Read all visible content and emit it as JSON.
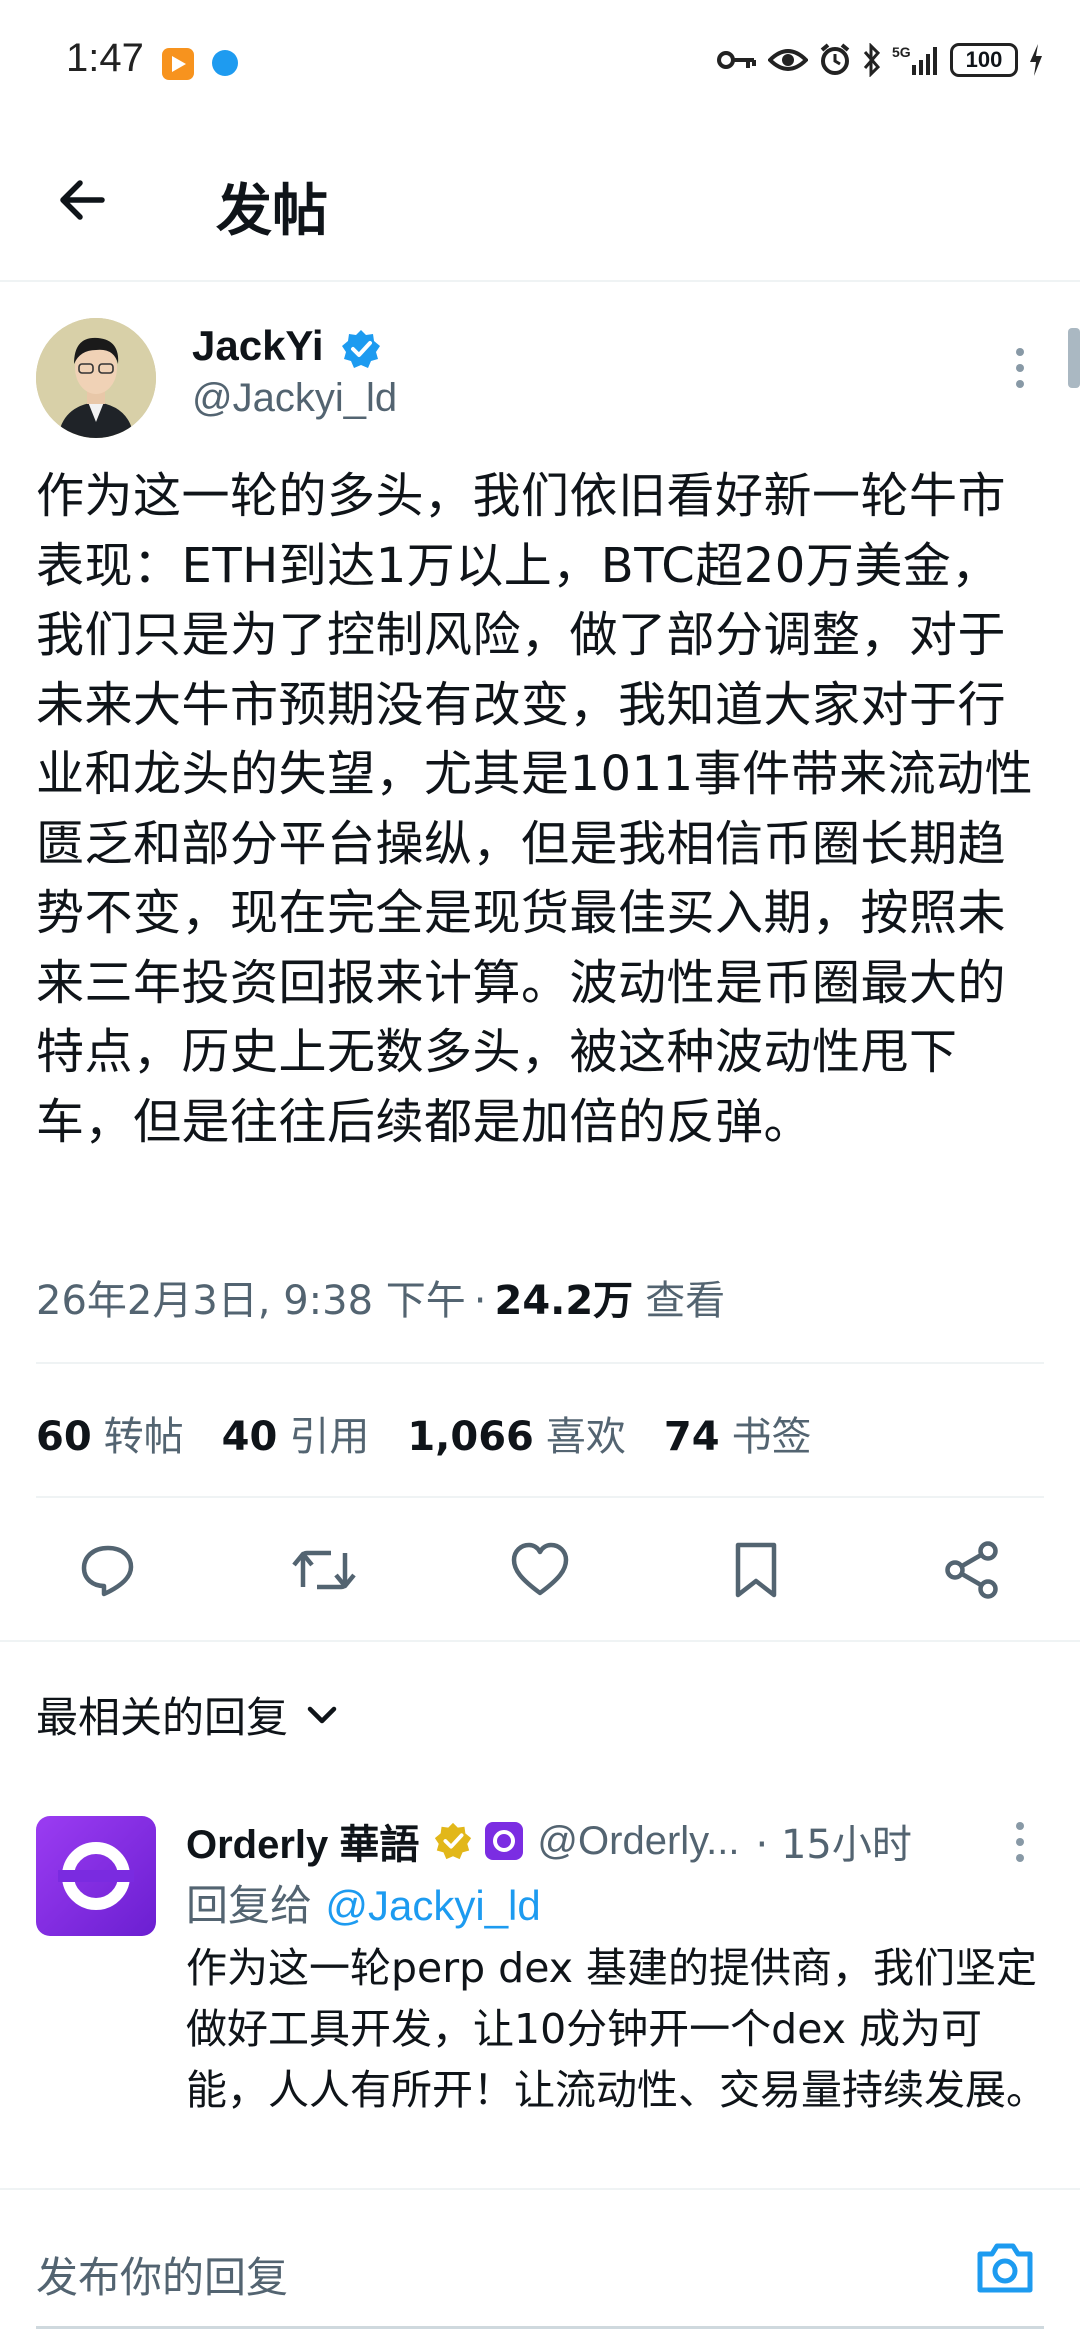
{
  "status_bar": {
    "time": "1:47",
    "network": "5G",
    "battery": "100"
  },
  "header": {
    "title": "发帖"
  },
  "post": {
    "author_name": "JackYi",
    "author_handle": "@Jackyi_ld",
    "body": "作为这一轮的多头，我们依旧看好新一轮牛市表现：ETH到达1万以上，BTC超20万美金，我们只是为了控制风险，做了部分调整，对于未来大牛市预期没有改变，我知道大家对于行业和龙头的失望，尤其是1011事件带来流动性匮乏和部分平台操纵，但是我相信币圈长期趋势不变，现在完全是现货最佳买入期，按照未来三年投资回报来计算。波动性是币圈最大的特点，历史上无数多头，被这种波动性甩下车，但是往往后续都是加倍的反弹。",
    "date": "26年2月3日, 9:38 下午",
    "separator": "·",
    "views": "24.2万",
    "views_label": "查看"
  },
  "stats": [
    {
      "count": "60",
      "label": "转帖"
    },
    {
      "count": "40",
      "label": "引用"
    },
    {
      "count": "1,066",
      "label": "喜欢"
    },
    {
      "count": "74",
      "label": "书签"
    }
  ],
  "actions": [
    {
      "icon": "reply-icon"
    },
    {
      "icon": "repost-icon"
    },
    {
      "icon": "like-icon"
    },
    {
      "icon": "bookmark-icon"
    },
    {
      "icon": "share-icon"
    }
  ],
  "replies_sort": {
    "label": "最相关的回复"
  },
  "reply": {
    "author_name": "Orderly 華語",
    "author_handle": "@Orderly...",
    "time": "· 15小时",
    "reply_to_label": "回复给",
    "reply_to_handle": "@Jackyi_ld",
    "body": "作为这一轮perp dex 基建的提供商，我们坚定做好工具开发，让10分钟开一个dex 成为可能，人人有所开！让流动性、交易量持续发展。"
  },
  "composer": {
    "placeholder": "发布你的回复"
  },
  "colors": {
    "accent": "#1d9bf0",
    "text": "#0f1419",
    "secondary": "#536471",
    "gold_badge": "#e2b719",
    "orderly_purple": "#7b2de2"
  }
}
